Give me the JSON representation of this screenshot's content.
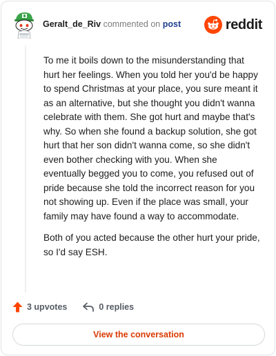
{
  "comment": {
    "username": "Geralt_de_Riv",
    "action_text": "commented on",
    "post_link": "post",
    "brand_name": "reddit",
    "body": [
      "To me it boils down to the misunderstanding that hurt her feelings. When you told her you'd be happy to spend Christmas at your place, you sure meant it as an alternative, but she thought you didn't wanna celebrate with them. She got hurt and maybe that's why. So when she found a backup solution, she got hurt that her son didn't wanna come, so she didn't even bother checking with you. When she eventually begged you to come, you refused out of pride because she told the incorrect reason for you not showing up. Even if the place was small, your family may have found a way to accommodate.",
      "Both of you acted because the other hurt your pride, so I'd say ESH."
    ],
    "upvotes": "3 upvotes",
    "replies": "0 replies",
    "cta_label": "View the conversation"
  },
  "icons": {
    "avatar": "snoo-avatar",
    "brand": "reddit-logo-icon",
    "upvote": "upvote-arrow-icon",
    "reply": "reply-arrow-icon"
  },
  "colors": {
    "accent": "#ff4500",
    "link": "#1f3f8f",
    "cta_text": "#d93900",
    "avatar_green": "#3aa54a"
  }
}
